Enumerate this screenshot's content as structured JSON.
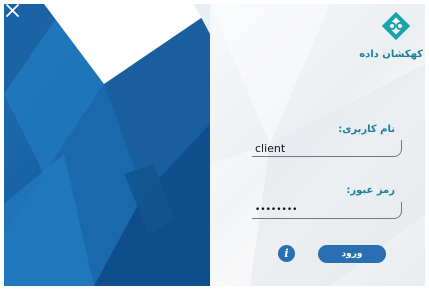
{
  "window": {
    "close_icon": "close-icon",
    "colors": {
      "panel_blue": "#1f6fb0",
      "accent": "#1b7f9a",
      "button": "#2a6fb2"
    }
  },
  "logo": {
    "text": "کهکشان داده",
    "icon": "logo-mark-icon"
  },
  "form": {
    "username_label": "نام کاربری:",
    "username_value": "client",
    "password_label": "رمز عبور:",
    "password_value": "••••••••",
    "info_icon": "info-icon",
    "info_label": "i",
    "login_label": "ورود"
  }
}
